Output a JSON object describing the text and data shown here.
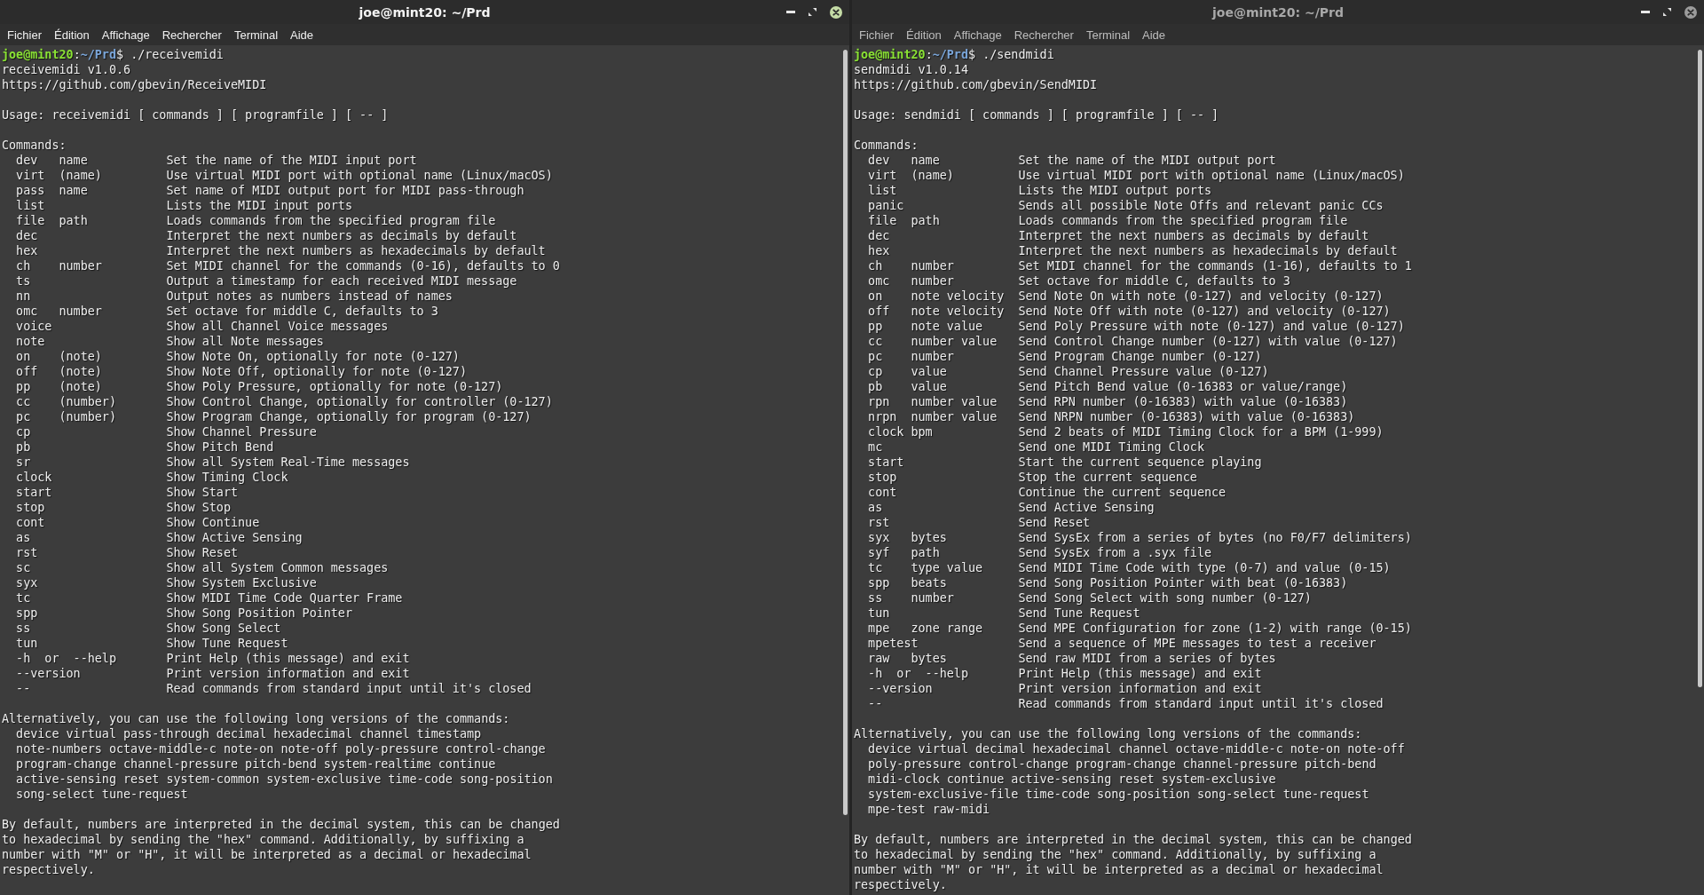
{
  "windows": [
    {
      "title": "joe@mint20: ~/Prd",
      "active": true,
      "menu": [
        "Fichier",
        "Édition",
        "Affichage",
        "Rechercher",
        "Terminal",
        "Aide"
      ],
      "prompt": {
        "user_host": "joe@mint20",
        "separator": ":",
        "path": "~/Prd",
        "symbol": "$",
        "command": "./receivemidi"
      },
      "version": "receivemidi v1.0.6",
      "url": "https://github.com/gbevin/ReceiveMIDI",
      "usage": "Usage: receivemidi [ commands ] [ programfile ] [ -- ]",
      "commands_heading": "Commands:",
      "commands": [
        {
          "command": "dev",
          "argument": "name",
          "description": "Set the name of the MIDI input port"
        },
        {
          "command": "virt",
          "argument": "(name)",
          "description": "Use virtual MIDI port with optional name (Linux/macOS)"
        },
        {
          "command": "pass",
          "argument": "name",
          "description": "Set name of MIDI output port for MIDI pass-through"
        },
        {
          "command": "list",
          "description": "Lists the MIDI input ports"
        },
        {
          "command": "file",
          "argument": "path",
          "description": "Loads commands from the specified program file"
        },
        {
          "command": "dec",
          "description": "Interpret the next numbers as decimals by default"
        },
        {
          "command": "hex",
          "description": "Interpret the next numbers as hexadecimals by default"
        },
        {
          "command": "ch",
          "argument": "number",
          "description": "Set MIDI channel for the commands (0-16), defaults to 0"
        },
        {
          "command": "ts",
          "description": "Output a timestamp for each received MIDI message"
        },
        {
          "command": "nn",
          "description": "Output notes as numbers instead of names"
        },
        {
          "command": "omc",
          "argument": "number",
          "description": "Set octave for middle C, defaults to 3"
        },
        {
          "command": "voice",
          "description": "Show all Channel Voice messages"
        },
        {
          "command": "note",
          "description": "Show all Note messages"
        },
        {
          "command": "on",
          "argument": "(note)",
          "description": "Show Note On, optionally for note (0-127)"
        },
        {
          "command": "off",
          "argument": "(note)",
          "description": "Show Note Off, optionally for note (0-127)"
        },
        {
          "command": "pp",
          "argument": "(note)",
          "description": "Show Poly Pressure, optionally for note (0-127)"
        },
        {
          "command": "cc",
          "argument": "(number)",
          "description": "Show Control Change, optionally for controller (0-127)"
        },
        {
          "command": "pc",
          "argument": "(number)",
          "description": "Show Program Change, optionally for program (0-127)"
        },
        {
          "command": "cp",
          "description": "Show Channel Pressure"
        },
        {
          "command": "pb",
          "description": "Show Pitch Bend"
        },
        {
          "command": "sr",
          "description": "Show all System Real-Time messages"
        },
        {
          "command": "clock",
          "description": "Show Timing Clock"
        },
        {
          "command": "start",
          "description": "Show Start"
        },
        {
          "command": "stop",
          "description": "Show Stop"
        },
        {
          "command": "cont",
          "description": "Show Continue"
        },
        {
          "command": "as",
          "description": "Show Active Sensing"
        },
        {
          "command": "rst",
          "description": "Show Reset"
        },
        {
          "command": "sc",
          "description": "Show all System Common messages"
        },
        {
          "command": "syx",
          "description": "Show System Exclusive"
        },
        {
          "command": "tc",
          "description": "Show MIDI Time Code Quarter Frame"
        },
        {
          "command": "spp",
          "description": "Show Song Position Pointer"
        },
        {
          "command": "ss",
          "description": "Show Song Select"
        },
        {
          "command": "tun",
          "description": "Show Tune Request"
        },
        {
          "command": "-h  or  --help",
          "description": "Print Help (this message) and exit"
        },
        {
          "command": "--version",
          "description": "Print version information and exit"
        },
        {
          "command": "--",
          "description": "Read commands from standard input until it's closed"
        }
      ],
      "alternatives_heading": "Alternatively, you can use the following long versions of the commands:",
      "long_versions": [
        "device virtual pass-through decimal hexadecimal channel timestamp",
        "note-numbers octave-middle-c note-on note-off poly-pressure control-change",
        "program-change channel-pressure pitch-bend system-realtime continue",
        "active-sensing reset system-common system-exclusive time-code song-position",
        "song-select tune-request"
      ],
      "note_lines": [
        "By default, numbers are interpreted in the decimal system, this can be changed",
        "to hexadecimal by sending the \"hex\" command. Additionally, by suffixing a",
        "number with \"M\" or \"H\", it will be interpreted as a decimal or hexadecimal",
        "respectively."
      ]
    },
    {
      "title": "joe@mint20: ~/Prd",
      "active": false,
      "menu": [
        "Fichier",
        "Édition",
        "Affichage",
        "Rechercher",
        "Terminal",
        "Aide"
      ],
      "prompt": {
        "user_host": "joe@mint20",
        "separator": ":",
        "path": "~/Prd",
        "symbol": "$",
        "command": "./sendmidi"
      },
      "version": "sendmidi v1.0.14",
      "url": "https://github.com/gbevin/SendMIDI",
      "usage": "Usage: sendmidi [ commands ] [ programfile ] [ -- ]",
      "commands_heading": "Commands:",
      "commands": [
        {
          "command": "dev",
          "argument": "name",
          "description": "Set the name of the MIDI output port"
        },
        {
          "command": "virt",
          "argument": "(name)",
          "description": "Use virtual MIDI port with optional name (Linux/macOS)"
        },
        {
          "command": "list",
          "description": "Lists the MIDI output ports"
        },
        {
          "command": "panic",
          "description": "Sends all possible Note Offs and relevant panic CCs"
        },
        {
          "command": "file",
          "argument": "path",
          "description": "Loads commands from the specified program file"
        },
        {
          "command": "dec",
          "description": "Interpret the next numbers as decimals by default"
        },
        {
          "command": "hex",
          "description": "Interpret the next numbers as hexadecimals by default"
        },
        {
          "command": "ch",
          "argument": "number",
          "description": "Set MIDI channel for the commands (1-16), defaults to 1"
        },
        {
          "command": "omc",
          "argument": "number",
          "description": "Set octave for middle C, defaults to 3"
        },
        {
          "command": "on",
          "argument": "note velocity",
          "description": "Send Note On with note (0-127) and velocity (0-127)"
        },
        {
          "command": "off",
          "argument": "note velocity",
          "description": "Send Note Off with note (0-127) and velocity (0-127)"
        },
        {
          "command": "pp",
          "argument": "note value",
          "description": "Send Poly Pressure with note (0-127) and value (0-127)"
        },
        {
          "command": "cc",
          "argument": "number value",
          "description": "Send Control Change number (0-127) with value (0-127)"
        },
        {
          "command": "pc",
          "argument": "number",
          "description": "Send Program Change number (0-127)"
        },
        {
          "command": "cp",
          "argument": "value",
          "description": "Send Channel Pressure value (0-127)"
        },
        {
          "command": "pb",
          "argument": "value",
          "description": "Send Pitch Bend value (0-16383 or value/range)"
        },
        {
          "command": "rpn",
          "argument": "number value",
          "description": "Send RPN number (0-16383) with value (0-16383)"
        },
        {
          "command": "nrpn",
          "argument": "number value",
          "description": "Send NRPN number (0-16383) with value (0-16383)"
        },
        {
          "command": "clock",
          "argument": "bpm",
          "description": "Send 2 beats of MIDI Timing Clock for a BPM (1-999)"
        },
        {
          "command": "mc",
          "description": "Send one MIDI Timing Clock"
        },
        {
          "command": "start",
          "description": "Start the current sequence playing"
        },
        {
          "command": "stop",
          "description": "Stop the current sequence"
        },
        {
          "command": "cont",
          "description": "Continue the current sequence"
        },
        {
          "command": "as",
          "description": "Send Active Sensing"
        },
        {
          "command": "rst",
          "description": "Send Reset"
        },
        {
          "command": "syx",
          "argument": "bytes",
          "description": "Send SysEx from a series of bytes (no F0/F7 delimiters)"
        },
        {
          "command": "syf",
          "argument": "path",
          "description": "Send SysEx from a .syx file"
        },
        {
          "command": "tc",
          "argument": "type value",
          "description": "Send MIDI Time Code with type (0-7) and value (0-15)"
        },
        {
          "command": "spp",
          "argument": "beats",
          "description": "Send Song Position Pointer with beat (0-16383)"
        },
        {
          "command": "ss",
          "argument": "number",
          "description": "Send Song Select with song number (0-127)"
        },
        {
          "command": "tun",
          "description": "Send Tune Request"
        },
        {
          "command": "mpe",
          "argument": "zone range",
          "description": "Send MPE Configuration for zone (1-2) with range (0-15)"
        },
        {
          "command": "mpetest",
          "description": "Send a sequence of MPE messages to test a receiver"
        },
        {
          "command": "raw",
          "argument": "bytes",
          "description": "Send raw MIDI from a series of bytes"
        },
        {
          "command": "-h  or  --help",
          "description": "Print Help (this message) and exit"
        },
        {
          "command": "--version",
          "description": "Print version information and exit"
        },
        {
          "command": "--",
          "description": "Read commands from standard input until it's closed"
        }
      ],
      "alternatives_heading": "Alternatively, you can use the following long versions of the commands:",
      "long_versions": [
        "device virtual decimal hexadecimal channel octave-middle-c note-on note-off",
        "poly-pressure control-change program-change channel-pressure pitch-bend",
        "midi-clock continue active-sensing reset system-exclusive",
        "system-exclusive-file time-code song-position song-select tune-request",
        "mpe-test raw-midi"
      ],
      "note_lines": [
        "By default, numbers are interpreted in the decimal system, this can be changed",
        "to hexadecimal by sending the \"hex\" command. Additionally, by suffixing a",
        "number with \"M\" or \"H\", it will be interpreted as a decimal or hexadecimal",
        "respectively."
      ]
    }
  ]
}
